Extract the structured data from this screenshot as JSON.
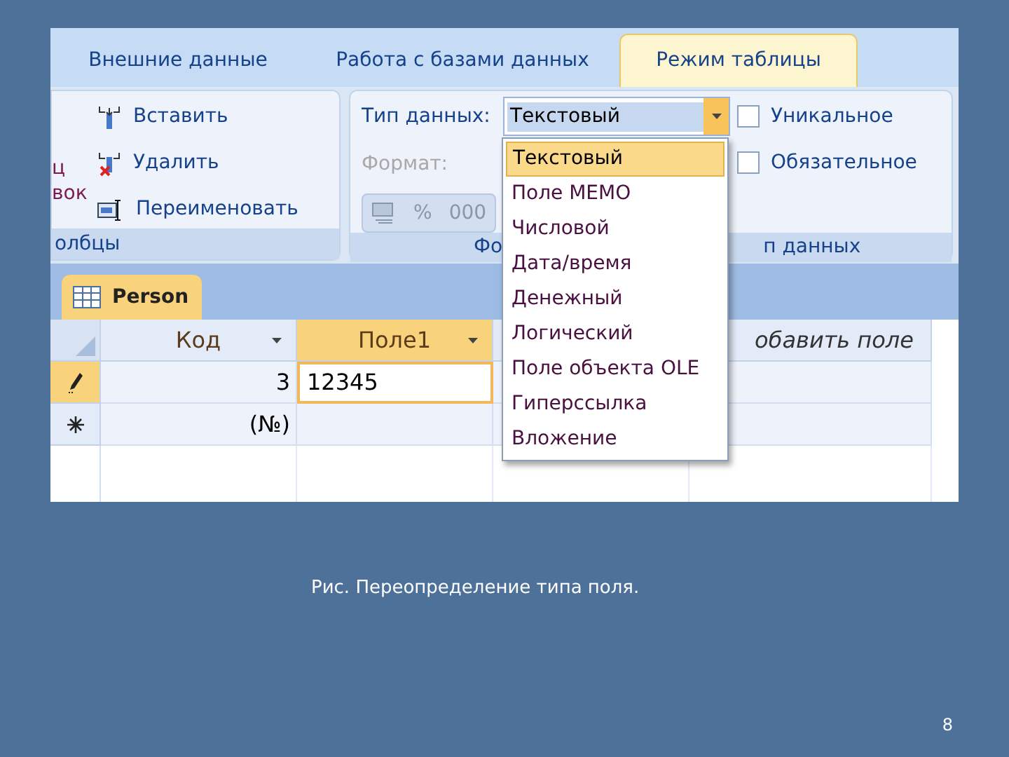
{
  "screenshot": {
    "ribbon_tabs": [
      {
        "label": "Внешние данные",
        "selected": false
      },
      {
        "label": "Работа с базами данных",
        "selected": false
      },
      {
        "label": "Режим таблицы",
        "selected": true
      }
    ],
    "fields_group": {
      "cut_texts": [
        "ц",
        "вок"
      ],
      "buttons": [
        {
          "kind": "insert",
          "label": "Вставить"
        },
        {
          "kind": "delete",
          "label": "Удалить"
        },
        {
          "kind": "rename",
          "label": "Переименовать"
        }
      ],
      "label": "олбцы"
    },
    "format_group": {
      "data_type_label": "Тип данных:",
      "data_type_value": "Текстовый",
      "format_label": "Формат:",
      "format_buttons": [
        {
          "kind": "icon"
        },
        {
          "kind": "text",
          "label": "%"
        },
        {
          "kind": "text",
          "label": "000"
        }
      ],
      "checkboxes": [
        {
          "label": "Уникальное",
          "checked": false
        },
        {
          "label": "Обязательное",
          "checked": false
        }
      ],
      "label_parts": [
        "Фо",
        "п данных"
      ]
    },
    "dropdown": {
      "items": [
        {
          "label": "Текстовый",
          "selected": true
        },
        {
          "label": "Поле MEMO",
          "selected": false
        },
        {
          "label": "Числовой",
          "selected": false
        },
        {
          "label": "Дата/время",
          "selected": false
        },
        {
          "label": "Денежный",
          "selected": false
        },
        {
          "label": "Логический",
          "selected": false
        },
        {
          "label": "Поле объекта OLE",
          "selected": false
        },
        {
          "label": "Гиперссылка",
          "selected": false
        },
        {
          "label": "Вложение",
          "selected": false
        }
      ]
    },
    "document_tab": "Person",
    "table": {
      "columns": [
        {
          "label": "Код",
          "kind": "field",
          "selected": false
        },
        {
          "label": "Поле1",
          "kind": "field",
          "selected": true
        },
        {
          "label": "обавить поле",
          "kind": "add",
          "selected": false
        }
      ],
      "rows": [
        {
          "kind": "edit",
          "cells": [
            {
              "text": "3",
              "selected": false
            },
            {
              "text": "12345",
              "selected": true
            }
          ]
        },
        {
          "kind": "new",
          "cells": [
            {
              "text": "(№)",
              "selected": false
            }
          ]
        }
      ]
    }
  },
  "caption": "Рис. Переопределение типа поля.",
  "page_number": "8"
}
